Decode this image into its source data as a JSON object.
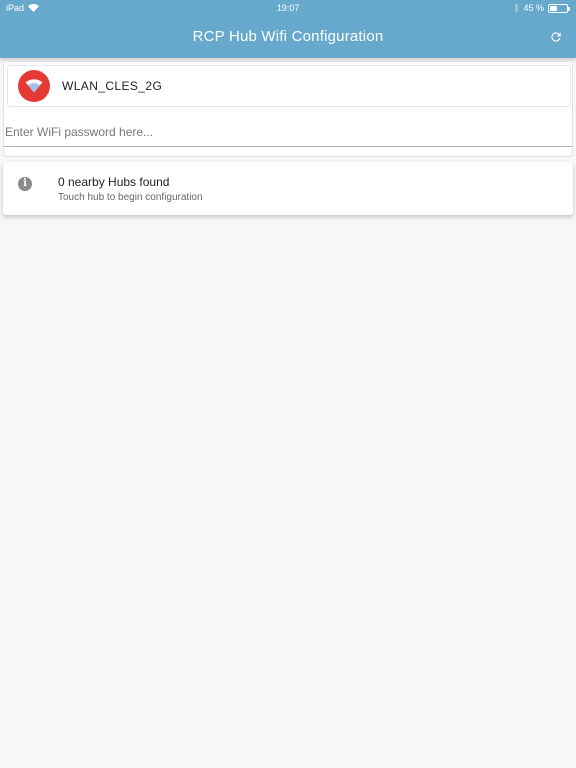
{
  "status_bar": {
    "device": "iPad",
    "time": "19:07",
    "battery_percent_text": "45 %",
    "battery_level": 0.45,
    "icons": [
      "wifi-icon",
      "bluetooth-icon",
      "battery-icon"
    ]
  },
  "nav": {
    "title": "RCP Hub Wifi Configuration",
    "refresh_icon": "refresh-icon"
  },
  "network": {
    "ssid": "WLAN_CLES_2G",
    "icon": "wifi-icon",
    "icon_color": "#e53935",
    "password_value": "",
    "password_placeholder": "Enter WiFi password here..."
  },
  "hubs": {
    "icon": "info-icon",
    "info_glyph": "i",
    "title": "0 nearby Hubs found",
    "subtitle": "Touch hub to begin configuration"
  },
  "colors": {
    "header": "#66a9cc",
    "background": "#f7f7f9"
  }
}
